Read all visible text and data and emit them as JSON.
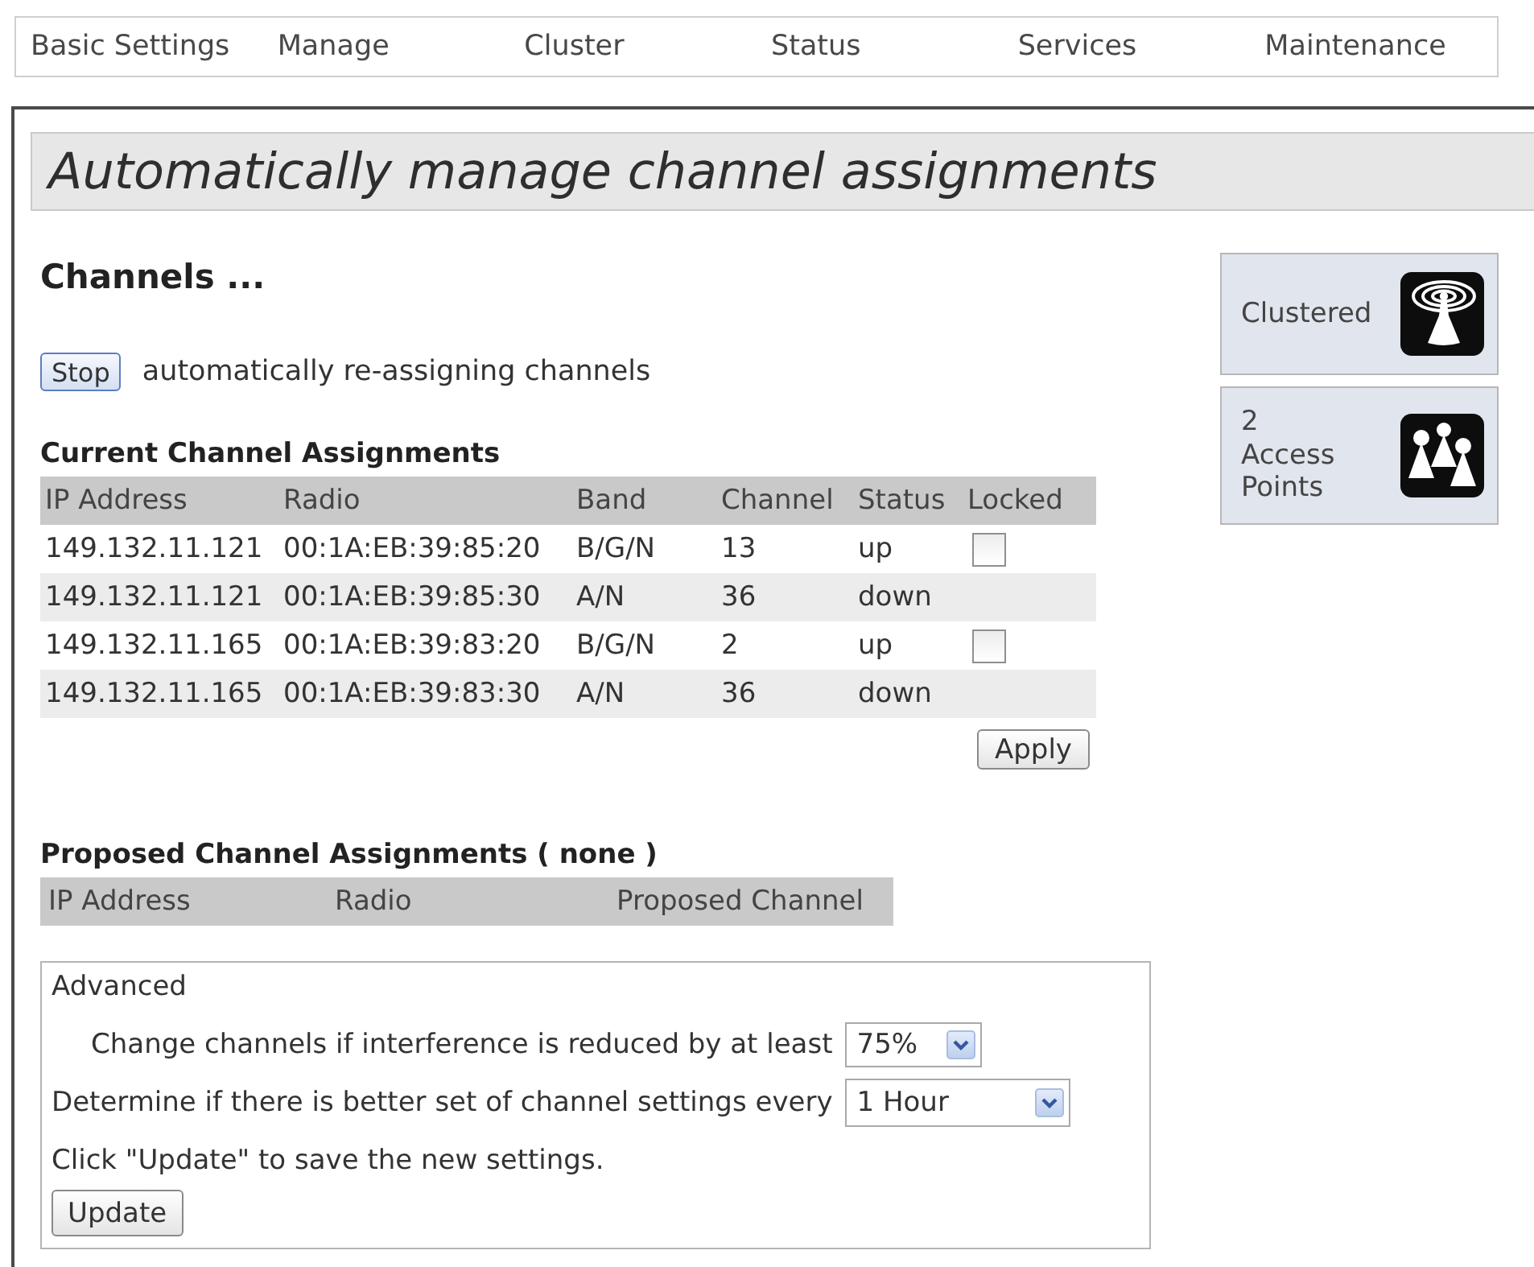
{
  "nav": {
    "items": [
      "Basic Settings",
      "Manage",
      "Cluster",
      "Status",
      "Services",
      "Maintenance"
    ]
  },
  "page": {
    "title": "Automatically manage channel assignments"
  },
  "channels": {
    "heading": "Channels ...",
    "stop_button": "Stop",
    "status_text": "automatically re-assigning channels"
  },
  "current_assignments": {
    "title": "Current Channel Assignments",
    "columns": [
      "IP Address",
      "Radio",
      "Band",
      "Channel",
      "Status",
      "Locked"
    ],
    "rows": [
      {
        "ip_address": "149.132.11.121",
        "radio": "00:1A:EB:39:85:20",
        "band": "B/G/N",
        "channel": "13",
        "status": "up",
        "locked": false
      },
      {
        "ip_address": "149.132.11.121",
        "radio": "00:1A:EB:39:85:30",
        "band": "A/N",
        "channel": "36",
        "status": "down"
      },
      {
        "ip_address": "149.132.11.165",
        "radio": "00:1A:EB:39:83:20",
        "band": "B/G/N",
        "channel": "2",
        "status": "up",
        "locked": false
      },
      {
        "ip_address": "149.132.11.165",
        "radio": "00:1A:EB:39:83:30",
        "band": "A/N",
        "channel": "36",
        "status": "down"
      }
    ],
    "apply_button": "Apply"
  },
  "proposed_assignments": {
    "title": "Proposed Channel Assignments ( none )",
    "columns": [
      "IP Address",
      "Radio",
      "Proposed Channel"
    ]
  },
  "advanced": {
    "title": "Advanced",
    "settings": [
      {
        "label": "Change channels if interference is reduced by at least",
        "value": "75%"
      },
      {
        "label": "Determine if there is better set of channel settings every",
        "value": "1 Hour"
      }
    ],
    "hint": "Click \"Update\" to save the new settings.",
    "update_button": "Update"
  },
  "cluster_status": [
    {
      "kind": "cluster",
      "label": "Clustered"
    },
    {
      "kind": "access_points",
      "label": "2 Access Points"
    }
  ]
}
